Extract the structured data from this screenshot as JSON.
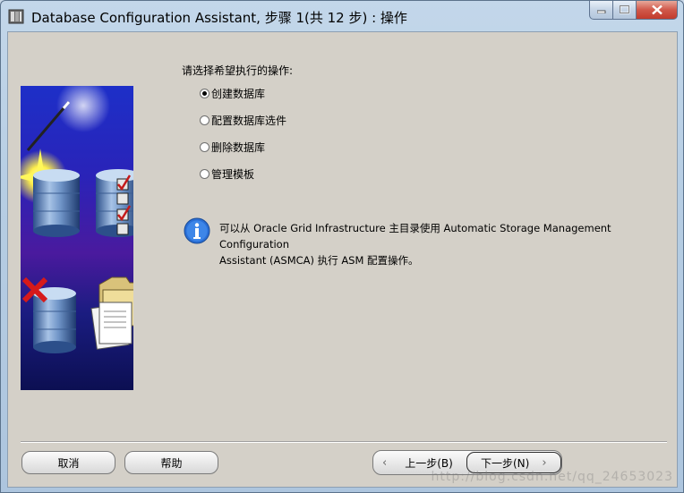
{
  "window": {
    "title": "Database Configuration Assistant, 步骤 1(共 12 步) : 操作",
    "icon": "database-app-icon"
  },
  "main": {
    "prompt": "请选择希望执行的操作:",
    "options": [
      {
        "label": "创建数据库",
        "selected": true
      },
      {
        "label": "配置数据库选件",
        "selected": false
      },
      {
        "label": "删除数据库",
        "selected": false
      },
      {
        "label": "管理模板",
        "selected": false
      }
    ],
    "info_line1": "可以从 Oracle Grid Infrastructure 主目录使用 Automatic Storage Management Configuration",
    "info_line2": "Assistant (ASMCA) 执行 ASM 配置操作。"
  },
  "footer": {
    "cancel": "取消",
    "help": "帮助",
    "back": "上一步(B)",
    "next": "下一步(N)"
  },
  "watermark": "http://blog.csdn.net/qq_24653023"
}
